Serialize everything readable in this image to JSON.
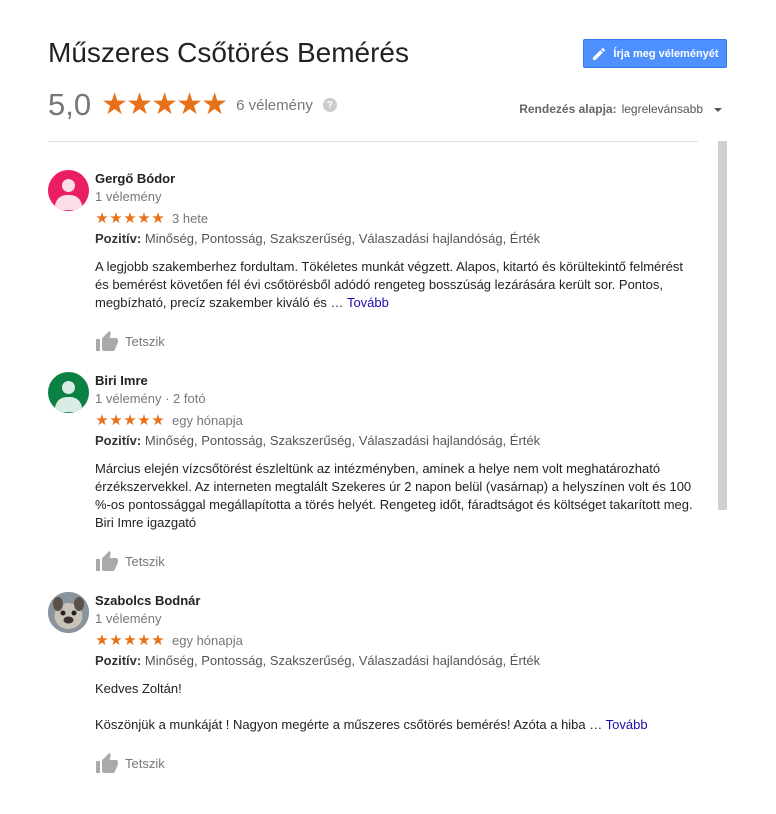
{
  "page": {
    "title": "Műszeres Csőtörés Bemérés",
    "write_review_label": "Írja meg véleményét",
    "score": "5,0",
    "stars": 5,
    "review_count": "6 vélemény",
    "help_icon": "help-circle-icon",
    "sort_label": "Rendezés alapja:",
    "sort_value": "legrelevánsabb"
  },
  "colors": {
    "star": "#e7711b",
    "button": "#4d90fe",
    "link": "#1a0dab"
  },
  "reviews": [
    {
      "name": "Gergő Bódor",
      "meta": "1 vélemény",
      "avatar_color": "#e91e63",
      "stars": 5,
      "date": "3 hete",
      "positive_label": "Pozitív:",
      "positive": "Minőség, Pontosság, Szakszerűség, Válaszadási hajlandóság, Érték",
      "text": "A legjobb szakemberhez fordultam. Tökéletes munkát végzett. Alapos, kitartó és körültekintő felmérést és bemérést követően fél évi csőtörésből adódó rengeteg bosszúság lezárására került sor. Pontos, megbízható, precíz szakember kiváló és …",
      "more": "Tovább",
      "like": "Tetszik"
    },
    {
      "name": "Biri Imre",
      "meta": "1 vélemény · 2 fotó",
      "avatar_color": "#0b8043",
      "stars": 5,
      "date": "egy hónapja",
      "positive_label": "Pozitív:",
      "positive": "Minőség, Pontosság, Szakszerűség, Válaszadási hajlandóság, Érték",
      "text": "Március elején vízcsőtörést észleltünk az intézményben, aminek a helye nem volt meghatározható érzékszervekkel. Az interneten megtalált Szekeres úr 2 napon belül (vasárnap) a helyszínen volt és 100 %-os pontossággal megállapította a törés helyét. Rengeteg időt, fáradtságot és költséget takarított meg. Biri Imre igazgató",
      "more": "",
      "like": "Tetszik"
    },
    {
      "name": "Szabolcs Bodnár",
      "meta": "1 vélemény",
      "avatar_color": "#7a8590",
      "stars": 5,
      "date": "egy hónapja",
      "positive_label": "Pozitív:",
      "positive": "Minőség, Pontosság, Szakszerűség, Válaszadási hajlandóság, Érték",
      "text_line1": "Kedves Zoltán!",
      "text": "Köszönjük a munkáját ! Nagyon megérte a műszeres csőtörés bemérés! Azóta a hiba …",
      "more": "Tovább",
      "like": "Tetszik"
    }
  ]
}
